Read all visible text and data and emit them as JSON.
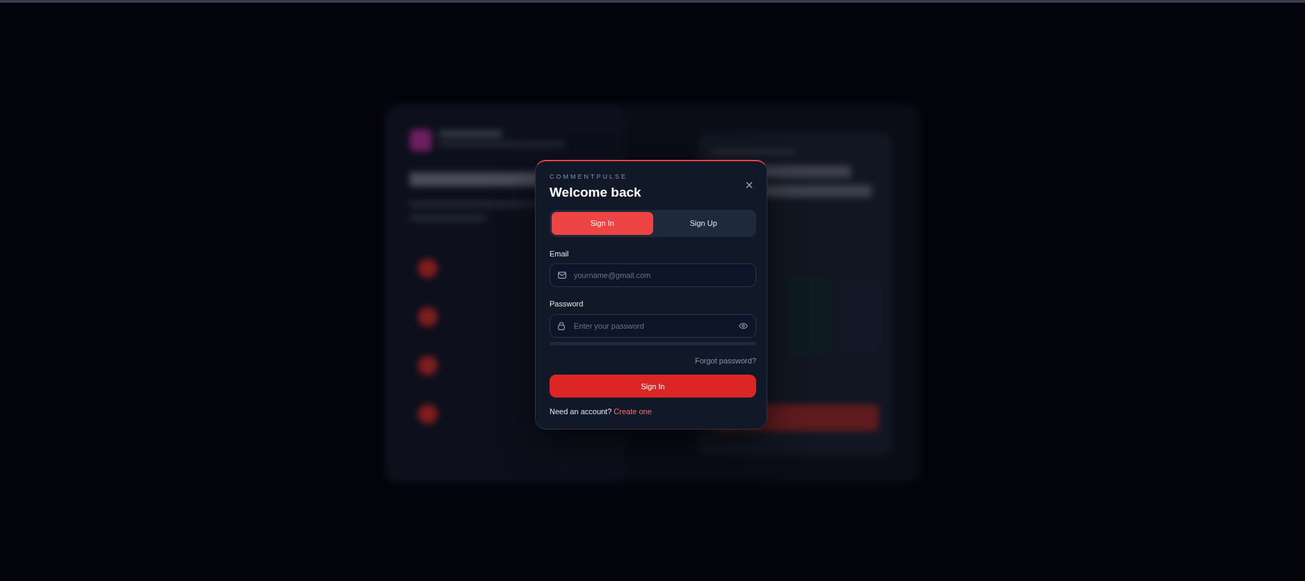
{
  "modal": {
    "brand": "COMMENTPULSE",
    "title": "Welcome back",
    "close": "×",
    "tabs": [
      {
        "label": "Sign In",
        "selected": true
      },
      {
        "label": "Sign Up",
        "selected": false
      }
    ],
    "fields": [
      {
        "kind": "email",
        "label": "Email",
        "placeholder": "yourname@gmail.com"
      },
      {
        "kind": "password",
        "label": "Password",
        "placeholder": "Enter your password"
      }
    ],
    "password_strength": {
      "level": 0
    },
    "forgot_link": "Forgot password?",
    "submit": "Sign In",
    "footer": {
      "text": "Need an account?",
      "link": "Create one"
    }
  }
}
